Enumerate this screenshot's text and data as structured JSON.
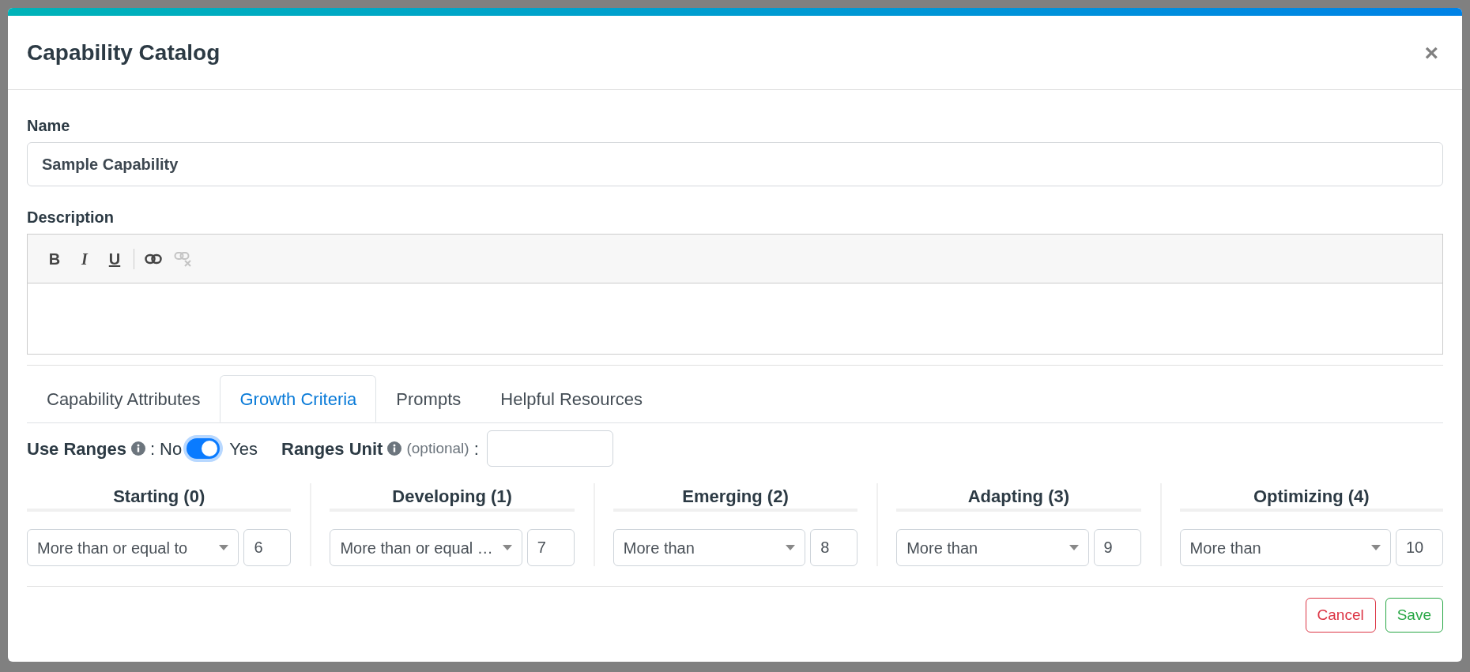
{
  "dialog": {
    "title": "Capability Catalog",
    "close": "×"
  },
  "name_field": {
    "label": "Name",
    "value": "Sample Capability"
  },
  "description": {
    "label": "Description",
    "toolbar": [
      {
        "kind": "bold",
        "label": "B",
        "disabled": false
      },
      {
        "kind": "italic",
        "label": "I",
        "disabled": false
      },
      {
        "kind": "underline",
        "label": "U",
        "disabled": false
      },
      {
        "kind": "link",
        "disabled": false
      },
      {
        "kind": "unlink",
        "disabled": true
      }
    ]
  },
  "tabs": [
    {
      "label": "Capability Attributes",
      "selected": false
    },
    {
      "label": "Growth Criteria",
      "selected": true
    },
    {
      "label": "Prompts",
      "selected": false
    },
    {
      "label": "Helpful Resources",
      "selected": false
    }
  ],
  "ranges": {
    "use_label": "Use Ranges",
    "separator": ":",
    "off_label": "No",
    "on_label": "Yes",
    "on": true,
    "unit_label": "Ranges Unit",
    "unit_hint": "(optional)",
    "unit_separator": ":"
  },
  "levels": [
    {
      "title": "Starting (0)",
      "operator": "More than or equal to",
      "value": "6"
    },
    {
      "title": "Developing (1)",
      "operator": "More than or equal …",
      "value": "7"
    },
    {
      "title": "Emerging (2)",
      "operator": "More than",
      "value": "8"
    },
    {
      "title": "Adapting (3)",
      "operator": "More than",
      "value": "9"
    },
    {
      "title": "Optimizing (4)",
      "operator": "More than",
      "value": "10"
    }
  ],
  "buttons": [
    {
      "kind": "cancel",
      "label": "Cancel"
    },
    {
      "kind": "save",
      "label": "Save"
    }
  ]
}
